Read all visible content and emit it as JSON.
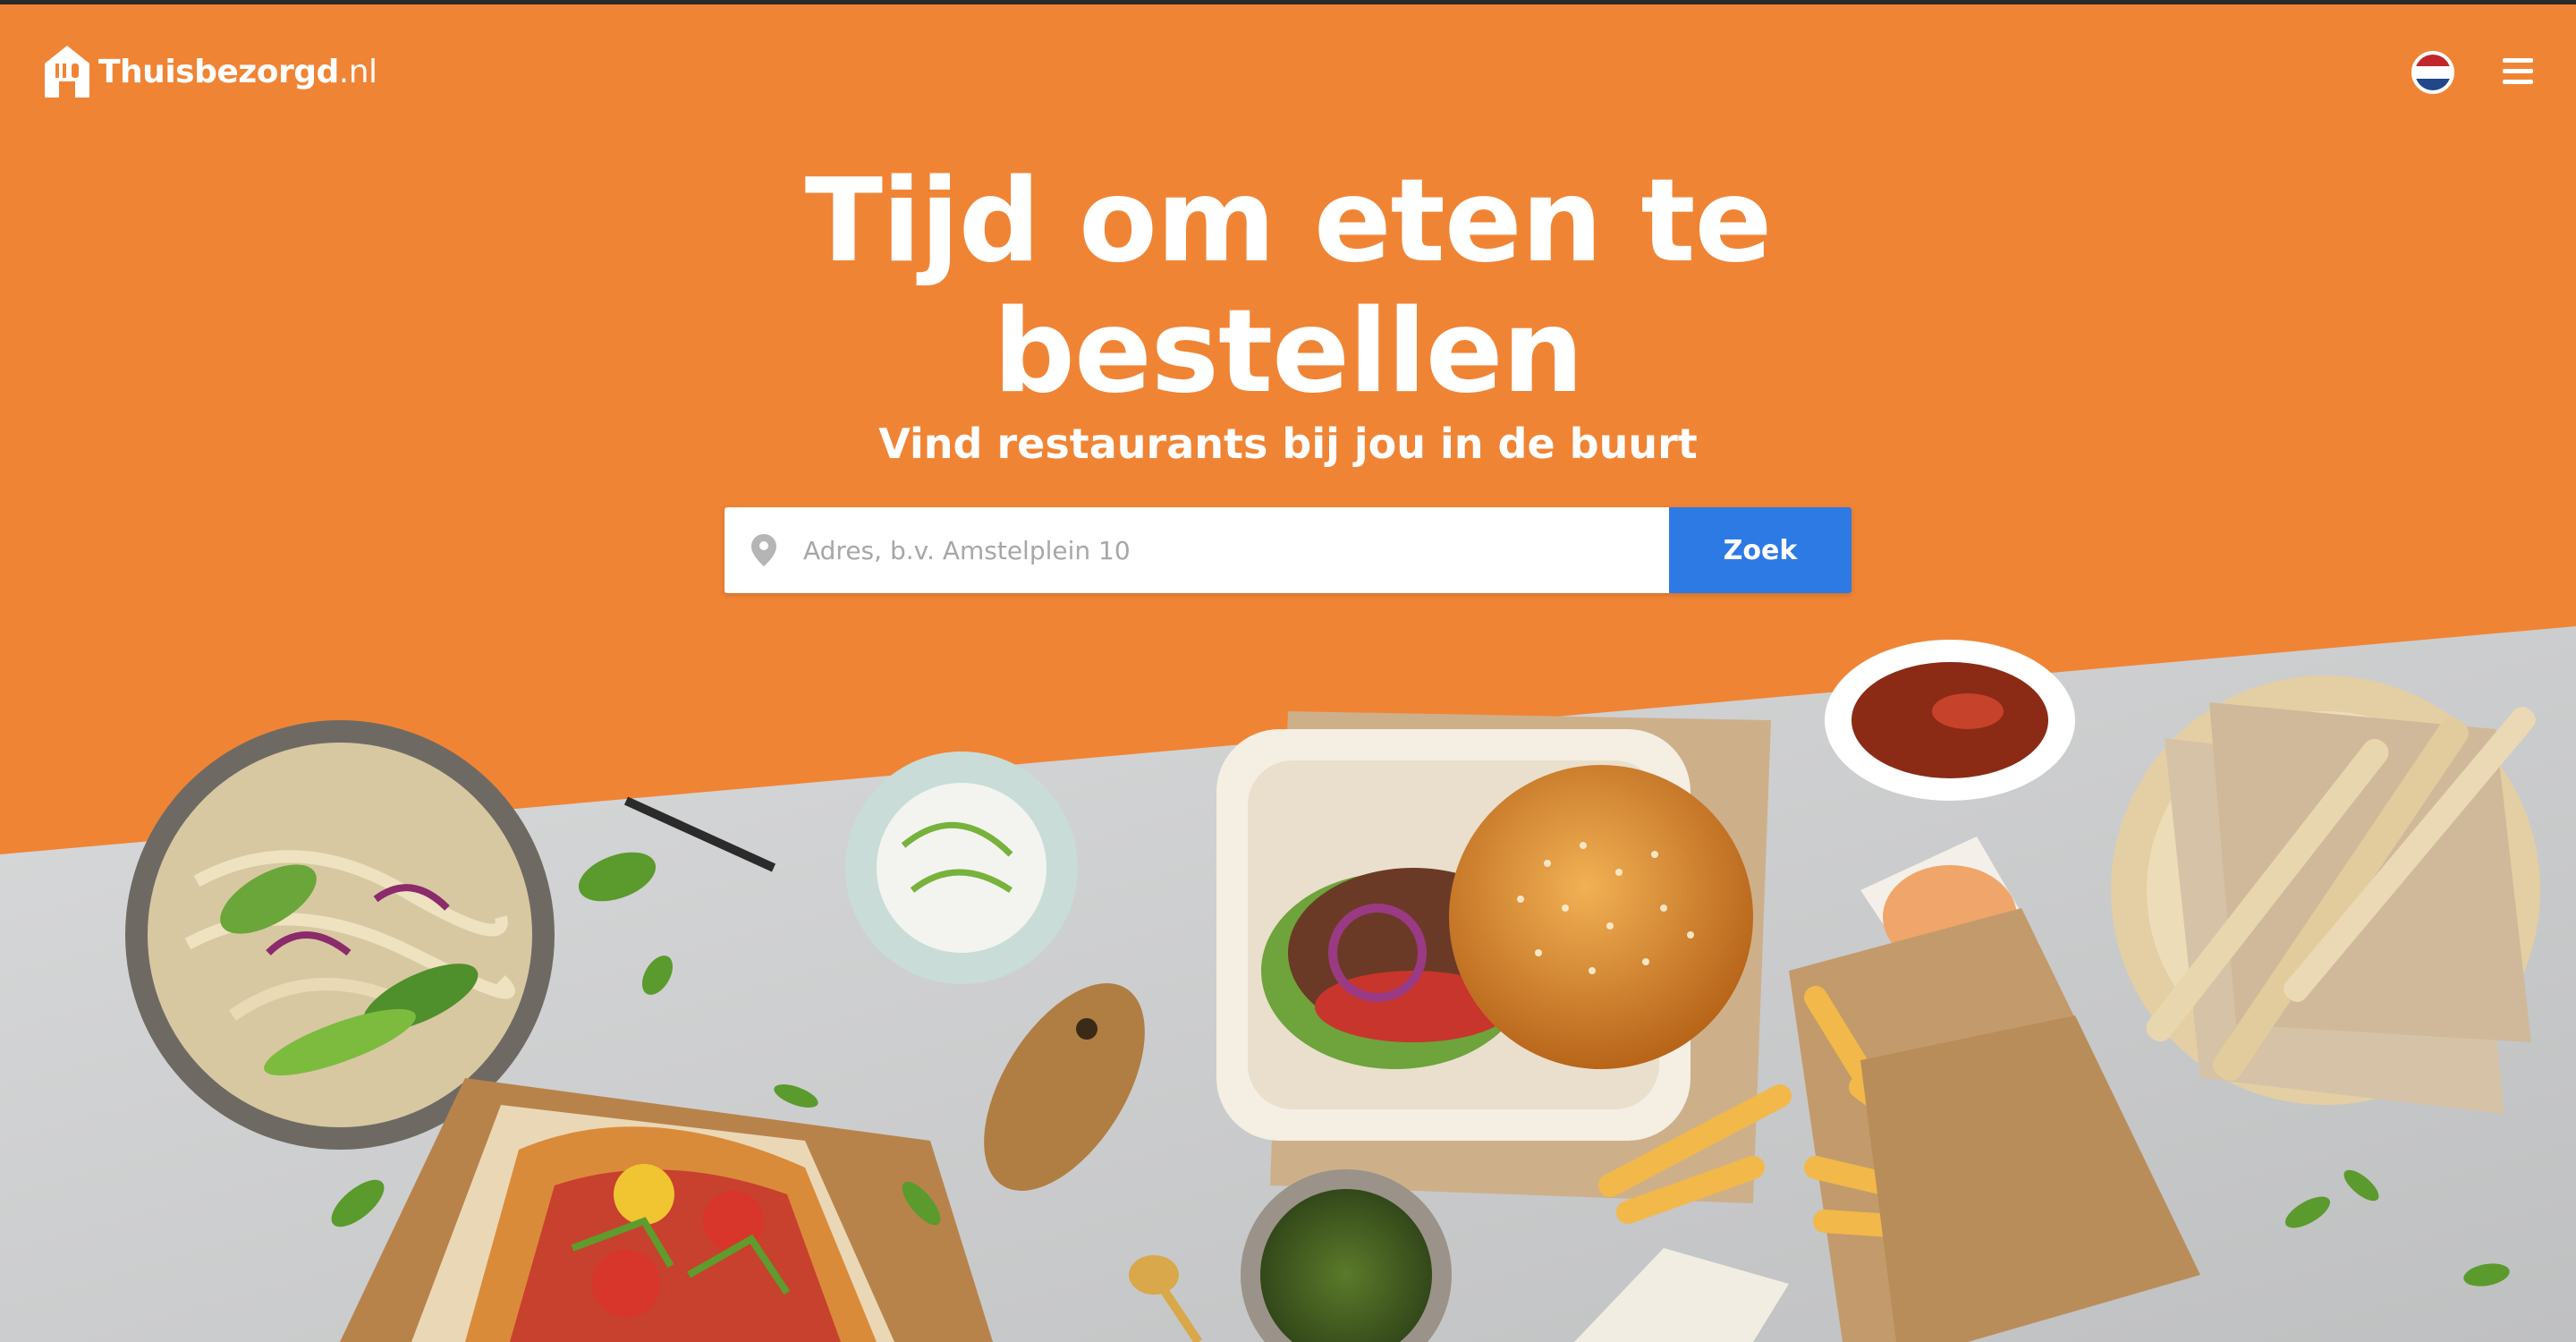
{
  "header": {
    "brand": "Thuisbezorgd",
    "brand_tld": ".nl",
    "language_flag": "netherlands-flag",
    "menu_icon": "hamburger-menu-icon"
  },
  "hero": {
    "title_line1": "Tijd om eten te",
    "title_line2": "bestellen",
    "subtitle": "Vind restaurants bij jou in de buurt"
  },
  "search": {
    "placeholder": "Adres, b.v. Amstelplein 10",
    "value": "",
    "button_label": "Zoek",
    "icon": "location-pin-icon"
  },
  "colors": {
    "brand_orange": "#f08435",
    "button_blue": "#2d7ae4",
    "table_grey": "#cfd0d0"
  }
}
